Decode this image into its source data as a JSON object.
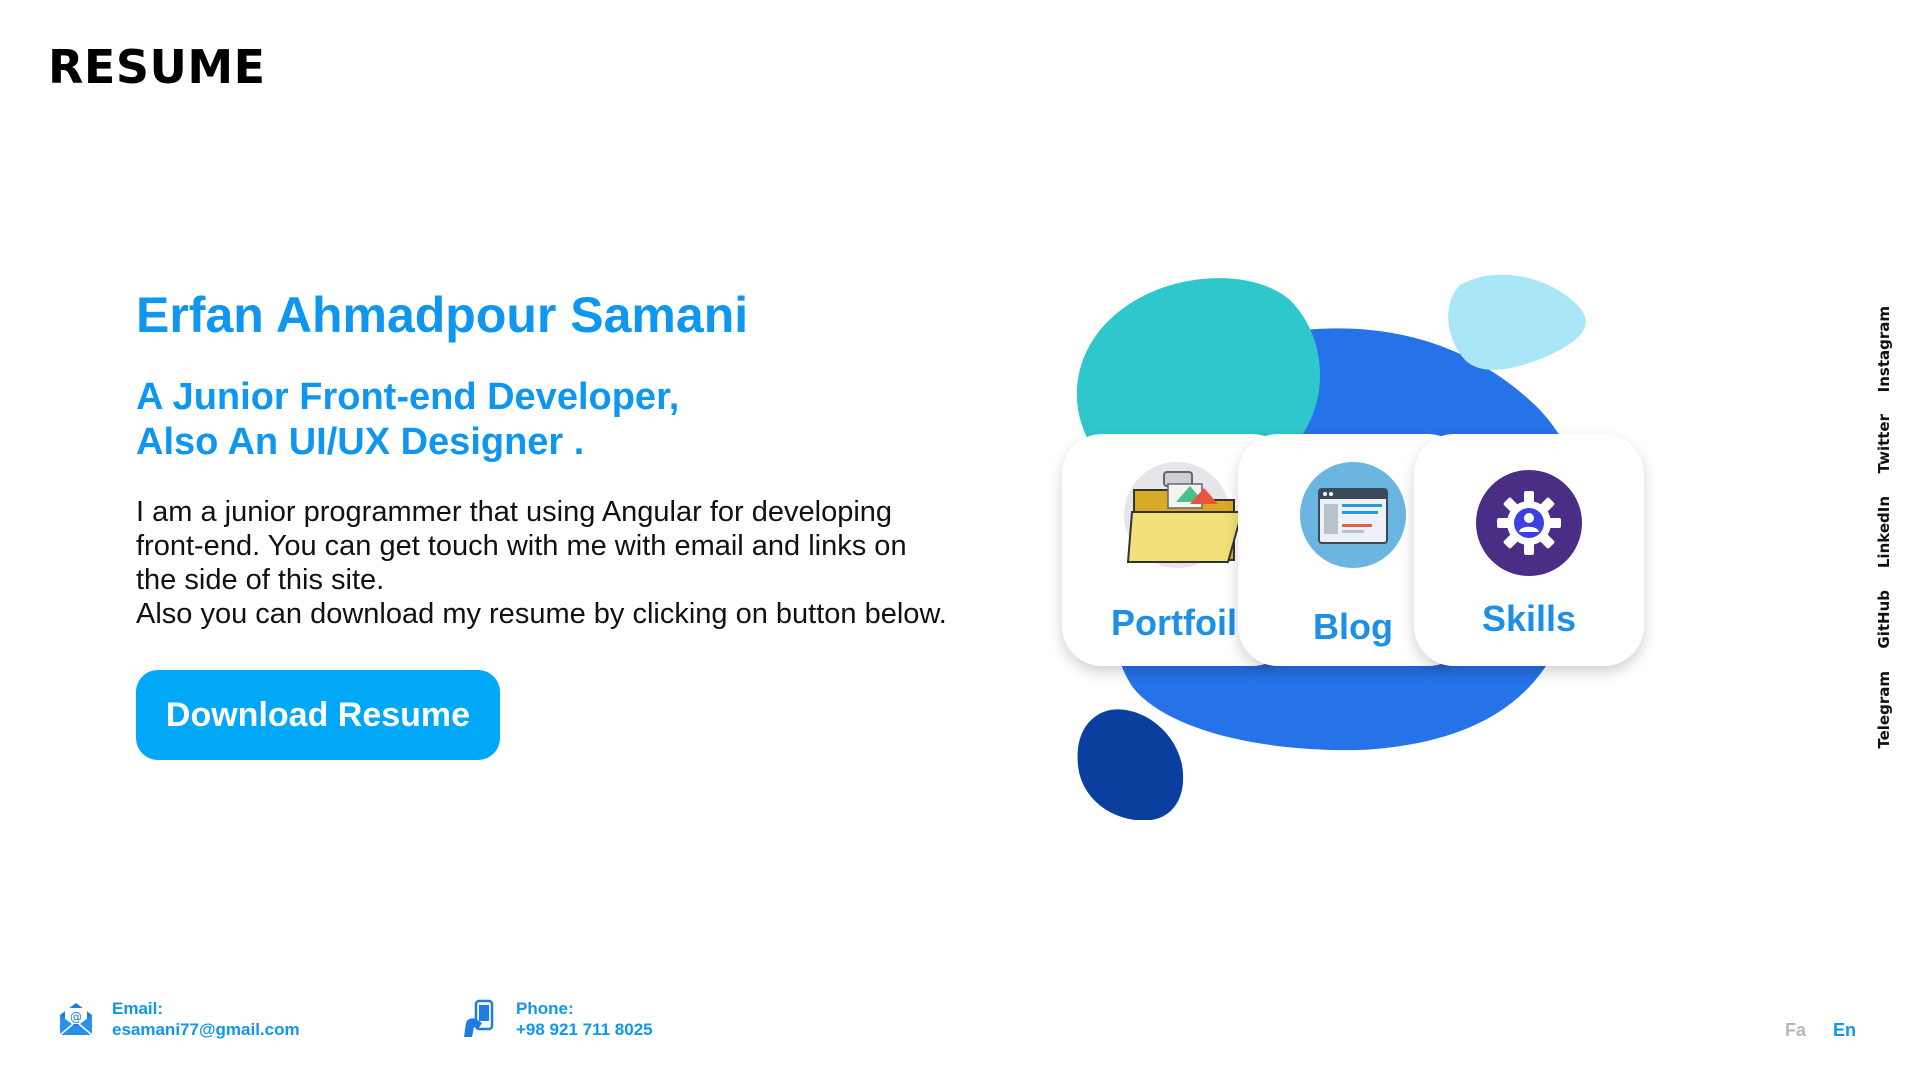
{
  "header": {
    "brand": "RESUME"
  },
  "hero": {
    "name": "Erfan Ahmadpour Samani",
    "tagline_line1": "A Junior Front-end Developer,",
    "tagline_line2": "Also An UI/UX Designer .",
    "bio_line1": "I am a junior programmer that using Angular for developing",
    "bio_line2": "front-end. You can get touch with me with email and links on",
    "bio_line3": "the side of this site.",
    "bio_line4": "Also you can download my resume by clicking on button below.",
    "download_label": "Download Resume"
  },
  "cards": {
    "portfolio": {
      "label": "Portfoilo",
      "icon": "folder-icon"
    },
    "blog": {
      "label": "Blog",
      "icon": "browser-window-icon"
    },
    "skills": {
      "label": "Skills",
      "icon": "gear-user-icon"
    }
  },
  "social": {
    "instagram": "Instagram",
    "twitter": "Twitter",
    "linkedin": "LinkedIn",
    "github": "GitHub",
    "telegram": "Telegram"
  },
  "footer": {
    "email_label": "Email:",
    "email_value": "esamani77@gmail.com",
    "phone_label": "Phone:",
    "phone_value": "+98 921 711 8025",
    "lang_fa": "Fa",
    "lang_en": "En"
  },
  "colors": {
    "accent": "#0f97ef",
    "button": "#00a8f7",
    "blob_teal": "#2ec8cc",
    "blob_blue": "#2672e8",
    "blob_light": "#a8e6f8",
    "blob_navy": "#0a3fa0"
  }
}
